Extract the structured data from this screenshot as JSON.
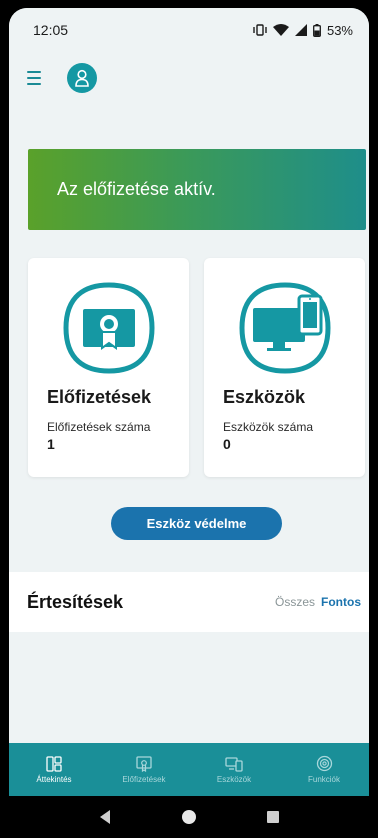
{
  "status": {
    "time": "12:05",
    "battery": "53%"
  },
  "banner": {
    "text": "Az előfizetése aktív."
  },
  "cards": [
    {
      "title": "Előfizetések",
      "subtitle": "Előfizetések száma",
      "count": "1"
    },
    {
      "title": "Eszközök",
      "subtitle": "Eszközök száma",
      "count": "0"
    }
  ],
  "protect_button": {
    "label": "Eszköz védelme"
  },
  "notifications": {
    "title": "Értesítések",
    "tab_all": "Összes",
    "tab_important": "Fontos"
  },
  "bottom_nav": [
    {
      "label": "Áttekintés",
      "icon": "overview-icon",
      "active": true
    },
    {
      "label": "Előfizetések",
      "icon": "certificate-icon",
      "active": false
    },
    {
      "label": "Eszközök",
      "icon": "devices-icon",
      "active": false
    },
    {
      "label": "Funkciók",
      "icon": "gear-icon",
      "active": false
    }
  ],
  "colors": {
    "accent": "#1a8f98",
    "button": "#1b73ad",
    "banner_start": "#5aa12a",
    "banner_end": "#1e8e8a"
  }
}
